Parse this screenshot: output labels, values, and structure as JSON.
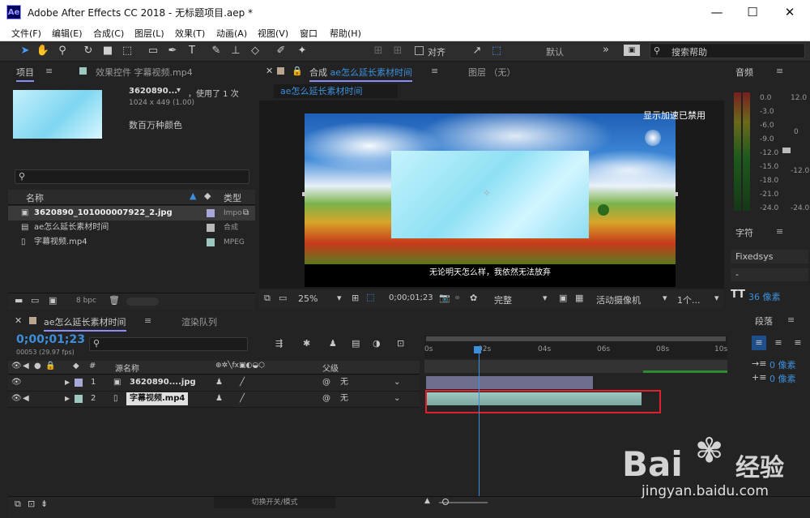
{
  "window": {
    "title": "Adobe After Effects CC 2018 - 无标题项目.aep *",
    "logo": "Ae"
  },
  "menu": [
    "文件(F)",
    "编辑(E)",
    "合成(C)",
    "图层(L)",
    "效果(T)",
    "动画(A)",
    "视图(V)",
    "窗口",
    "帮助(H)"
  ],
  "toolbar": {
    "align_label": "对齐",
    "workspace": "默认",
    "search_placeholder": "搜索帮助"
  },
  "project": {
    "tab_label": "项目",
    "effects_tab": "效果控件 字幕视频.mp4",
    "thumb_name": "3620890...",
    "used": "，使用了 1 次",
    "dimensions": "1024 x 449 (1.00)",
    "colors": "数百万种颜色",
    "col_name": "名称",
    "col_type": "类型",
    "items": [
      {
        "name": "3620890_101000007922_2.jpg",
        "type": "Impo",
        "color": "#a8a8d8"
      },
      {
        "name": "ae怎么延长素材时间",
        "type": "合成",
        "color": "#9ec7c0"
      },
      {
        "name": "字幕视频.mp4",
        "type": "MPEG",
        "color": "#9ec7c0"
      }
    ],
    "bpc": "8 bpc"
  },
  "composition": {
    "tab_label": "合成",
    "comp_name": "ae怎么延长素材时间",
    "sub_tab": "ae怎么延长素材时间",
    "layer_tab": "图层 （无）",
    "gpu_notice": "显示加速已禁用",
    "subtitle": "无论明天怎么样，我依然无法放弃",
    "zoom": "25%",
    "timecode": "0;00;01;23",
    "resolution": "完整",
    "camera": "活动摄像机",
    "views": "1个..."
  },
  "audio": {
    "tab_label": "音频",
    "levels": [
      "0.0",
      "-3.0",
      "-6.0",
      "-9.0",
      "-12.0",
      "-15.0",
      "-18.0",
      "-21.0",
      "-24.0"
    ],
    "db": [
      "12.0",
      "0",
      "-12.0",
      "-24.0"
    ]
  },
  "character": {
    "tab_label": "字符",
    "font": "Fixedsys",
    "style": "-",
    "size": "36 像素"
  },
  "paragraph": {
    "tab_label": "段落",
    "indent1": "0 像素",
    "indent2": "0 像素"
  },
  "timeline": {
    "tab_label": "ae怎么延长素材时间",
    "render_tab": "渲染队列",
    "timecode": "0;00;01;23",
    "frame_info": "00053 (29.97 fps)",
    "col_source": "源名称",
    "col_parent": "父级",
    "ruler": [
      "0s",
      "02s",
      "04s",
      "06s",
      "08s",
      "10s"
    ],
    "layers": [
      {
        "num": "1",
        "name": "3620890....jpg",
        "parent": "无",
        "color": "#a8a8d8"
      },
      {
        "num": "2",
        "name": "字幕视频.mp4",
        "parent": "无",
        "color": "#9ec7c0"
      }
    ],
    "switch_mode": "切换开关/模式"
  },
  "watermark": {
    "brand": "Bai",
    "brand2": "经验",
    "url": "jingyan.baidu.com"
  }
}
